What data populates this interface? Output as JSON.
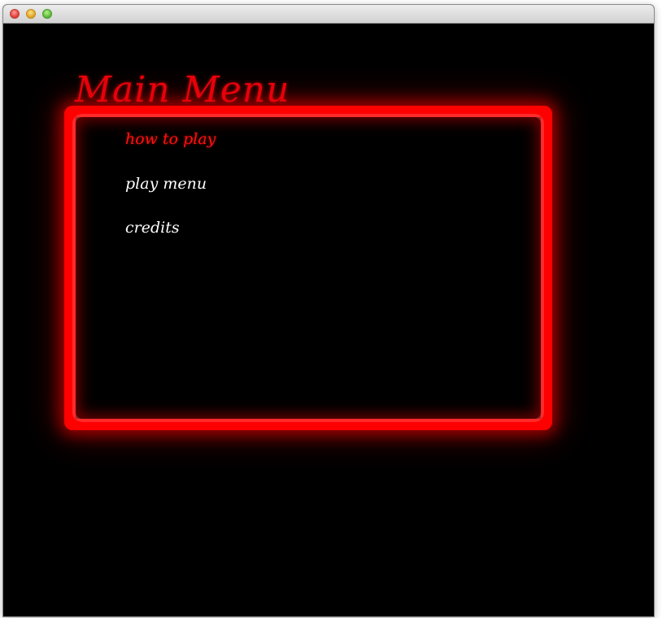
{
  "window": {
    "controls": [
      "close",
      "minimize",
      "zoom"
    ]
  },
  "game": {
    "title": "Main Menu",
    "menu_items": [
      {
        "label": "how to play",
        "selected": true
      },
      {
        "label": "play menu",
        "selected": false
      },
      {
        "label": "credits",
        "selected": false
      }
    ],
    "colors": {
      "background": "#000000",
      "neon": "#ff0000",
      "title": "#e8000a",
      "item": "#ffffff",
      "item_selected": "#ff1010"
    }
  }
}
